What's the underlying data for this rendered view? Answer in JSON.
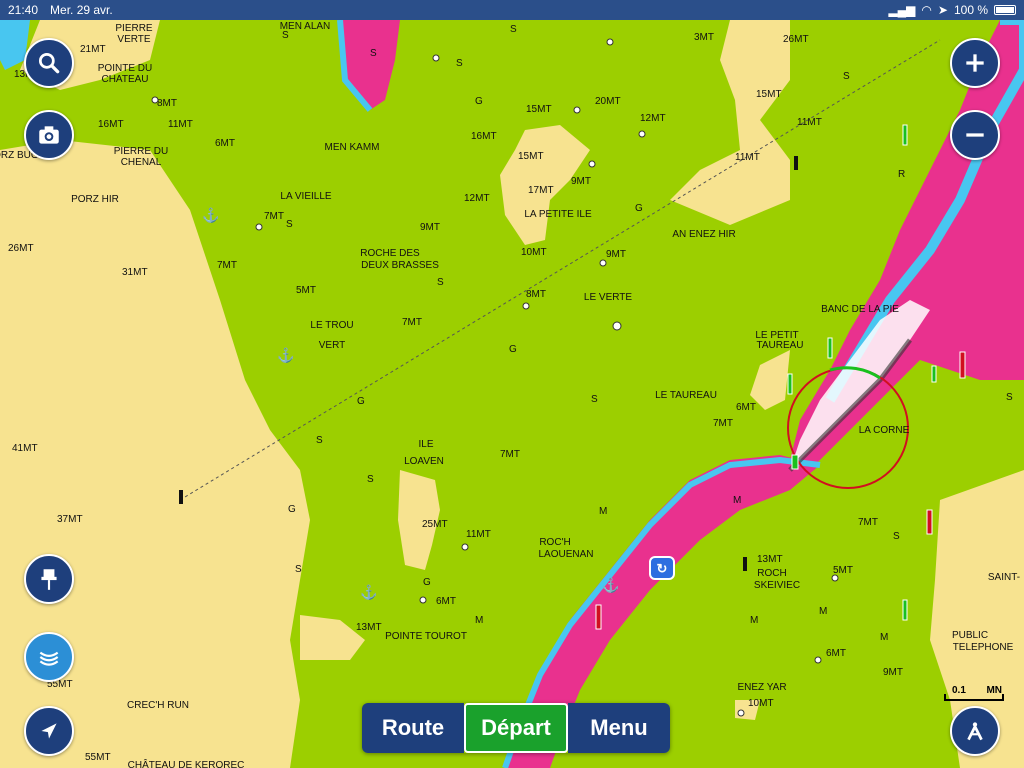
{
  "status": {
    "time": "21:40",
    "date": "Mer. 29 avr.",
    "battery": "100 %",
    "battery_level": 1.0
  },
  "buttons": {
    "route": "Route",
    "start": "Départ",
    "menu": "Menu"
  },
  "scale": {
    "value": "0.1",
    "unit": "MN"
  },
  "places": [
    "PIERRE VERTE",
    "MEN ALAN",
    "POINTE DU CHATEAU",
    "PIERRE DU CHENAL",
    "PORZ BUGALE",
    "PORZ HIR",
    "MEN KAMM",
    "LA VIEILLE",
    "ROCHE DES",
    "DEUX BRASSES",
    "LA PETITE ILE",
    "AN ENEZ HIR",
    "LE VERTE",
    "LE TROU",
    "VERT",
    "LE PETIT",
    "TAUREAU",
    "BANC DE LA PIE",
    "LE TAUREAU",
    "LA CORNE",
    "ILE",
    "LOAVEN",
    "ROC'H",
    "LAOUENAN",
    "ROCH",
    "SKEIVIEC",
    "POINTE TOUROT",
    "CREC'H RUN",
    "ENEZ YAR",
    "PUBLIC",
    "TELEPHONE",
    "SAINT-",
    "CHÂTEAU DE KEROREC"
  ],
  "depths": [
    "21MT",
    "13MT",
    "16MT",
    "11MT",
    "6MT",
    "8MT",
    "26MT",
    "31MT",
    "7MT",
    "7MT",
    "5MT",
    "7MT",
    "9MT",
    "12MT",
    "17MT",
    "15MT",
    "15MT",
    "16MT",
    "12MT",
    "20MT",
    "15MT",
    "11MT",
    "26MT",
    "10MT",
    "9MT",
    "8MT",
    "9MT",
    "6MT",
    "7MT",
    "41MT",
    "37MT",
    "7MT",
    "25MT",
    "11MT",
    "13MT",
    "6MT",
    "13MT",
    "7MT",
    "5MT",
    "6MT",
    "9MT",
    "10MT",
    "55MT",
    "55MT",
    "7MT",
    "3MT"
  ],
  "seabed_marks": [
    "S",
    "G",
    "M",
    "R",
    "S",
    "G",
    "S",
    "M"
  ]
}
